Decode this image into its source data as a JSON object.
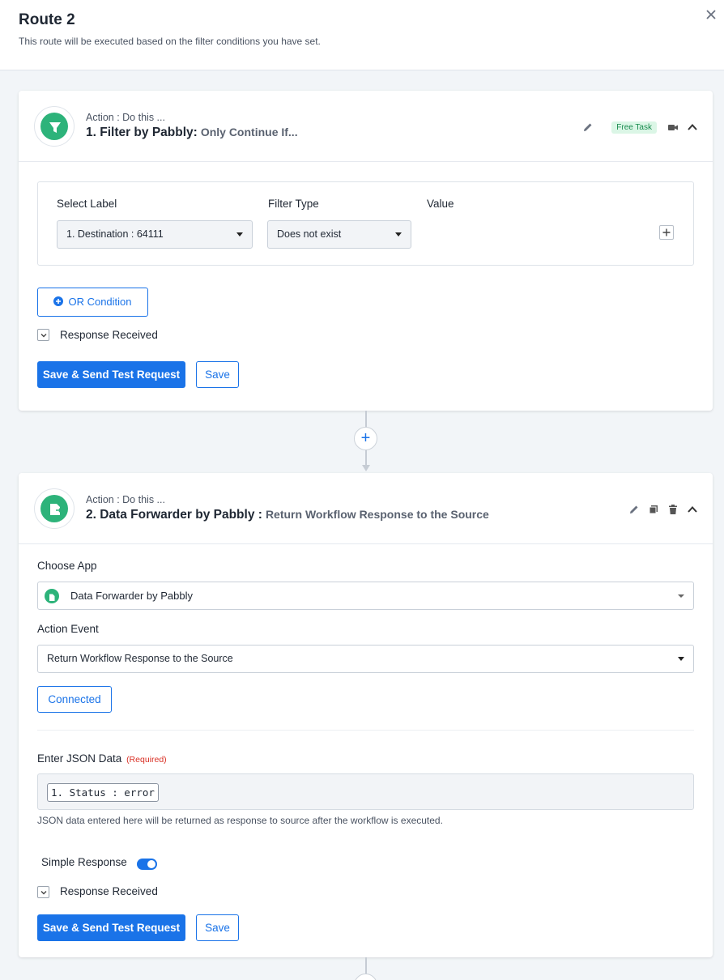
{
  "header": {
    "title": "Route 2",
    "subtitle": "This route will be executed based on the filter conditions you have set."
  },
  "step1": {
    "kicker": "Action : Do this ...",
    "title": "1. Filter by Pabbly:",
    "subtitle": "Only Continue If...",
    "badge": "Free Task",
    "filter": {
      "label_header": "Select Label",
      "type_header": "Filter Type",
      "value_header": "Value",
      "selected_label": "1. Destination : 64111",
      "selected_type": "Does not exist"
    },
    "or_condition_label": "OR Condition",
    "response_label": "Response Received",
    "save_send_label": "Save & Send Test Request",
    "save_label": "Save"
  },
  "step2": {
    "kicker": "Action : Do this ...",
    "title": "2. Data Forwarder by Pabbly :",
    "subtitle": "Return Workflow Response to the Source",
    "choose_app_label": "Choose App",
    "app_value": "Data Forwarder by Pabbly",
    "action_event_label": "Action Event",
    "action_event_value": "Return Workflow Response to the Source",
    "connected_label": "Connected",
    "json_label": "Enter JSON Data",
    "required_label": "(Required)",
    "json_token": "1. Status : error",
    "json_help": "JSON data entered here will be returned as response to source after the workflow is executed.",
    "simple_response_label": "Simple Response",
    "response_label": "Response Received",
    "save_send_label": "Save & Send Test Request",
    "save_label": "Save"
  },
  "colors": {
    "primary": "#1a73e8",
    "brand_green": "#2db37a",
    "required_red": "#d93025"
  }
}
